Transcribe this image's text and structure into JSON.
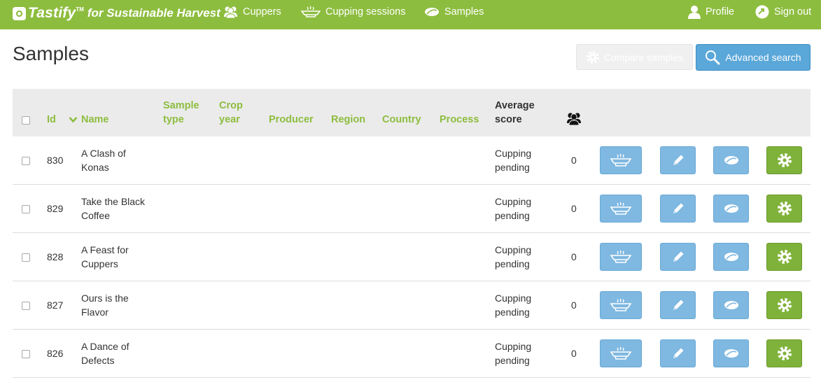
{
  "nav": {
    "brand_name": "Tastify",
    "brand_tm": "TM",
    "brand_sub": "for Sustainable Harvest",
    "cuppers_label": "Cuppers",
    "sessions_label": "Cupping sessions",
    "samples_label": "Samples",
    "profile_label": "Profile",
    "signout_label": "Sign out"
  },
  "page": {
    "title": "Samples",
    "compare_label": "Compare samples",
    "advanced_search_label": "Advanced search"
  },
  "table": {
    "columns": {
      "id": "Id",
      "name": "Name",
      "sample_type_1": "Sample",
      "sample_type_2": "type",
      "crop_year_1": "Crop",
      "crop_year_2": "year",
      "producer": "Producer",
      "region": "Region",
      "country": "Country",
      "process": "Process",
      "avg_score_1": "Average",
      "avg_score_2": "score"
    },
    "rows": [
      {
        "id": "830",
        "name_1": "A Clash of",
        "name_2": "Konas",
        "score_1": "Cupping",
        "score_2": "pending",
        "cuppers": "0"
      },
      {
        "id": "829",
        "name_1": "Take the Black",
        "name_2": "Coffee",
        "score_1": "Cupping",
        "score_2": "pending",
        "cuppers": "0"
      },
      {
        "id": "828",
        "name_1": "A Feast for",
        "name_2": "Cuppers",
        "score_1": "Cupping",
        "score_2": "pending",
        "cuppers": "0"
      },
      {
        "id": "827",
        "name_1": "Ours is the",
        "name_2": "Flavor",
        "score_1": "Cupping",
        "score_2": "pending",
        "cuppers": "0"
      },
      {
        "id": "826",
        "name_1": "A Dance of",
        "name_2": "Defects",
        "score_1": "Cupping",
        "score_2": "pending",
        "cuppers": "0"
      }
    ]
  },
  "colors": {
    "brand_green": "#8dbd3f",
    "action_blue": "#7fb8e0",
    "action_green": "#7fb23a",
    "header_gray": "#ebebeb"
  },
  "icons": {
    "brand": "logo-icon",
    "cuppers": "people-icon",
    "sessions": "cup-icon",
    "samples": "bean-icon",
    "profile": "user-icon",
    "signout": "signout-icon",
    "compare": "gear-icon",
    "search": "search-icon",
    "sort": "chevron-down-icon"
  }
}
